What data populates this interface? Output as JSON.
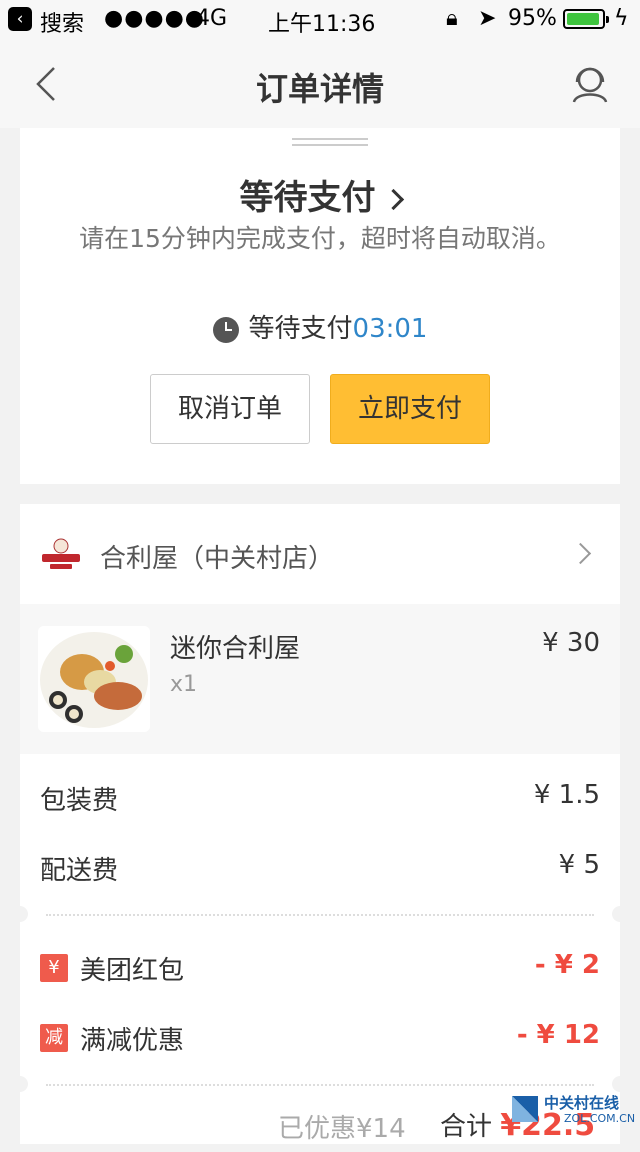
{
  "status_bar": {
    "back_app": "搜索",
    "signal": "●●●●●",
    "network": "4G",
    "time": "上午11:36",
    "battery": "95%",
    "battery_level": 0.95
  },
  "nav": {
    "title": "订单详情"
  },
  "order_status": {
    "title": "等待支付",
    "description": "请在15分钟内完成支付，超时将自动取消。",
    "timer_label": "等待支付",
    "timer_value": "03:01",
    "cancel_label": "取消订单",
    "pay_label": "立即支付"
  },
  "shop": {
    "name": "合利屋（中关村店）"
  },
  "items": [
    {
      "name": "迷你合利屋",
      "qty": "x1",
      "price": "¥ 30"
    }
  ],
  "fees": [
    {
      "label": "包装费",
      "value": "¥ 1.5"
    },
    {
      "label": "配送费",
      "value": "¥ 5"
    }
  ],
  "discounts": [
    {
      "badge": "¥",
      "label": "美团红包",
      "value": "- ¥ 2"
    },
    {
      "badge": "减",
      "label": "满减优惠",
      "value": "- ¥ 12"
    }
  ],
  "summary": {
    "saved": "已优惠¥14",
    "total_label": "合计",
    "total_value": "¥22.5"
  },
  "watermark": {
    "text": "中关村在线",
    "sub": "ZOL.COM.CN"
  },
  "colors": {
    "accent_yellow": "#ffbe33",
    "timer_blue": "#2f86c9",
    "discount_red": "#ef4b3f"
  }
}
